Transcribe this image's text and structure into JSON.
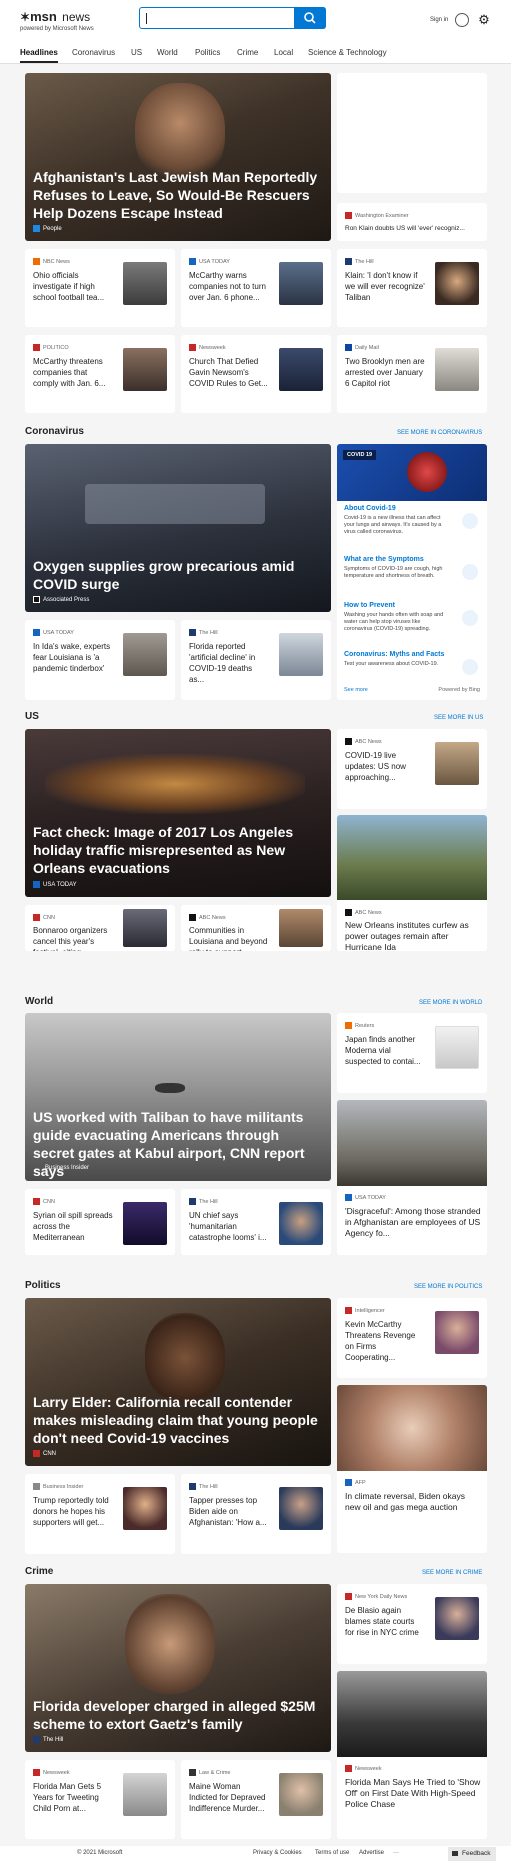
{
  "header": {
    "brand": "msn",
    "section": "news",
    "powered_by": "powered by Microsoft News",
    "search": {
      "value": "",
      "placeholder": ""
    },
    "sign_in": "Sign in"
  },
  "nav": {
    "tabs": [
      "Headlines",
      "Coronavirus",
      "US",
      "World",
      "Politics",
      "Crime",
      "Local",
      "Science & Technology"
    ],
    "active": "Headlines"
  },
  "headlines": {
    "hero": {
      "title": "Afghanistan's Last Jewish Man Reportedly Refuses to Leave, So Would-Be Rescuers Help Dozens Escape Instead",
      "source": "People"
    },
    "side": {
      "source": "Washington Examiner",
      "title": "Ron Klain doubts US will 'ever' recogniz..."
    },
    "row1": [
      {
        "source": "NBC News",
        "title": "Ohio officials investigate if high school football tea..."
      },
      {
        "source": "USA TODAY",
        "title": "McCarthy warns companies not to turn over Jan. 6 phone..."
      },
      {
        "source": "The Hill",
        "title": "Klain: 'I don't know if we will ever recognize' Taliban"
      }
    ],
    "row2": [
      {
        "source": "POLITICO",
        "title": "McCarthy threatens companies that comply with Jan. 6..."
      },
      {
        "source": "Newsweek",
        "title": "Church That Defied Gavin Newsom's COVID Rules to Get..."
      },
      {
        "source": "Daily Mail",
        "title": "Two Brooklyn men are arrested over January 6 Capitol riot"
      }
    ]
  },
  "coronavirus": {
    "title": "Coronavirus",
    "see_more": "SEE MORE IN CORONAVIRUS",
    "hero": {
      "title": "Oxygen supplies grow precarious amid COVID surge",
      "source": "Associated Press"
    },
    "row": [
      {
        "source": "USA TODAY",
        "title": "In Ida's wake, experts fear Louisiana is 'a pandemic tinderbox'"
      },
      {
        "source": "The Hill",
        "title": "Florida reported 'artificial decline' in COVID-19 deaths as..."
      }
    ],
    "info": {
      "badge": "COVID 19",
      "items": [
        {
          "title": "About Covid-19",
          "desc": "Covid-19 is a new illness that can affect your lungs and airways. It's caused by a virus called coronavirus."
        },
        {
          "title": "What are the Symptoms",
          "desc": "Symptoms of COVID-19 are cough, high temperature and shortness of breath."
        },
        {
          "title": "How to Prevent",
          "desc": "Washing your hands often with soap and water can help stop viruses like coronavirus (COVID-19) spreading."
        },
        {
          "title": "Coronavirus: Myths and Facts",
          "desc": "Test your awareness about COVID-19."
        }
      ],
      "see_more": "See more",
      "powered": "Powered by Bing"
    }
  },
  "us": {
    "title": "US",
    "see_more": "SEE MORE IN US",
    "hero": {
      "title": "Fact check: Image of 2017 Los Angeles holiday traffic misrepresented as New Orleans evacuations",
      "source": "USA TODAY"
    },
    "side1": {
      "source": "ABC News",
      "title": "COVID-19 live updates: US now approaching..."
    },
    "side2": {
      "source": "ABC News",
      "title": "New Orleans institutes curfew as power outages remain after Hurricane Ida"
    },
    "row": [
      {
        "source": "CNN",
        "title": "Bonnaroo organizers cancel this year's festival, citing..."
      },
      {
        "source": "ABC News",
        "title": "Communities in Louisiana and beyond rally to support..."
      }
    ]
  },
  "world": {
    "title": "World",
    "see_more": "SEE MORE IN WORLD",
    "hero": {
      "title": "US worked with Taliban to have militants guide evacuating Americans through secret gates at Kabul airport, CNN report says",
      "source": "Business Insider"
    },
    "side1": {
      "source": "Reuters",
      "title": "Japan finds another Moderna vial suspected to contai..."
    },
    "side2": {
      "source": "USA TODAY",
      "title": "'Disgraceful': Among those stranded in Afghanistan are employees of US Agency fo..."
    },
    "row": [
      {
        "source": "CNN",
        "title": "Syrian oil spill spreads across the Mediterranean"
      },
      {
        "source": "The Hill",
        "title": "UN chief says 'humanitarian catastrophe looms' i..."
      }
    ]
  },
  "politics": {
    "title": "Politics",
    "see_more": "SEE MORE IN POLITICS",
    "hero": {
      "title": "Larry Elder: California recall contender makes misleading claim that young people don't need Covid-19 vaccines",
      "source": "CNN"
    },
    "side1": {
      "source": "Intelligencer",
      "title": "Kevin McCarthy Threatens Revenge on Firms Cooperating..."
    },
    "side2": {
      "source": "AFP",
      "title": "In climate reversal, Biden okays new oil and gas mega auction"
    },
    "row": [
      {
        "source": "Business Insider",
        "title": "Trump reportedly told donors he hopes his supporters will get..."
      },
      {
        "source": "The Hill",
        "title": "Tapper presses top Biden aide on Afghanistan: 'How a..."
      }
    ]
  },
  "crime": {
    "title": "Crime",
    "see_more": "SEE MORE IN CRIME",
    "hero": {
      "title": "Florida developer charged in alleged $25M scheme to extort Gaetz's family",
      "source": "The Hill"
    },
    "side1": {
      "source": "New York Daily News",
      "title": "De Blasio again blames state courts for rise in NYC crime"
    },
    "side2": {
      "source": "Newsweek",
      "title": "Florida Man Says He Tried to 'Show Off' on First Date With High-Speed Police Chase"
    },
    "row": [
      {
        "source": "Newsweek",
        "title": "Florida Man Gets 5 Years for Tweeting Child Porn at..."
      },
      {
        "source": "Law & Crime",
        "title": "Maine Woman Indicted for Depraved Indifference Murder..."
      }
    ]
  },
  "footer": {
    "copyright": "© 2021 Microsoft",
    "links": [
      "Privacy & Cookies",
      "Terms of use",
      "Advertise"
    ],
    "more": "···",
    "feedback": "Feedback"
  },
  "colors": {
    "accent": "#0078d4"
  }
}
